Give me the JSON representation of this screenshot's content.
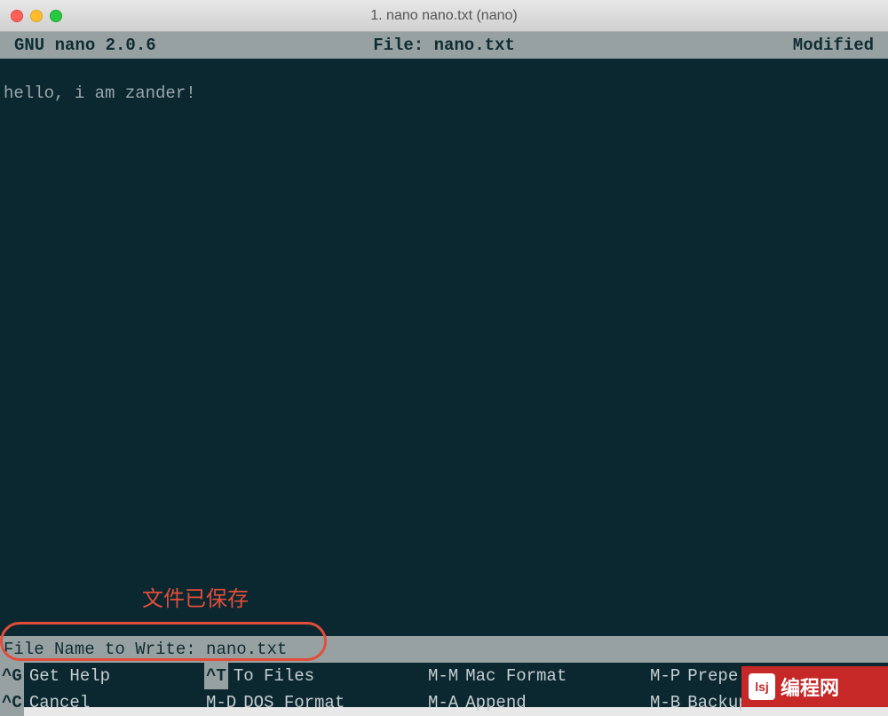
{
  "window": {
    "title": "1. nano nano.txt (nano)"
  },
  "header": {
    "app_version": "GNU nano 2.0.6",
    "file_label": "File: nano.txt",
    "status": "Modified"
  },
  "editor": {
    "content": "hello, i am zander!"
  },
  "annotation": {
    "text": "文件已保存"
  },
  "prompt": {
    "text": "File Name to Write: nano.txt"
  },
  "shortcuts": {
    "row1": [
      {
        "key": "^G",
        "label": "Get Help"
      },
      {
        "key": "^T",
        "label": "To Files"
      },
      {
        "key": "M-M",
        "label": "Mac Format"
      },
      {
        "key": "M-P",
        "label": "Prepe"
      }
    ],
    "row2": [
      {
        "key": "^C",
        "label": "Cancel"
      },
      {
        "key": "M-D",
        "label": "DOS Format"
      },
      {
        "key": "M-A",
        "label": "Append"
      },
      {
        "key": "M-B",
        "label": "Backup F"
      }
    ]
  },
  "watermark": {
    "text": "编程网"
  }
}
